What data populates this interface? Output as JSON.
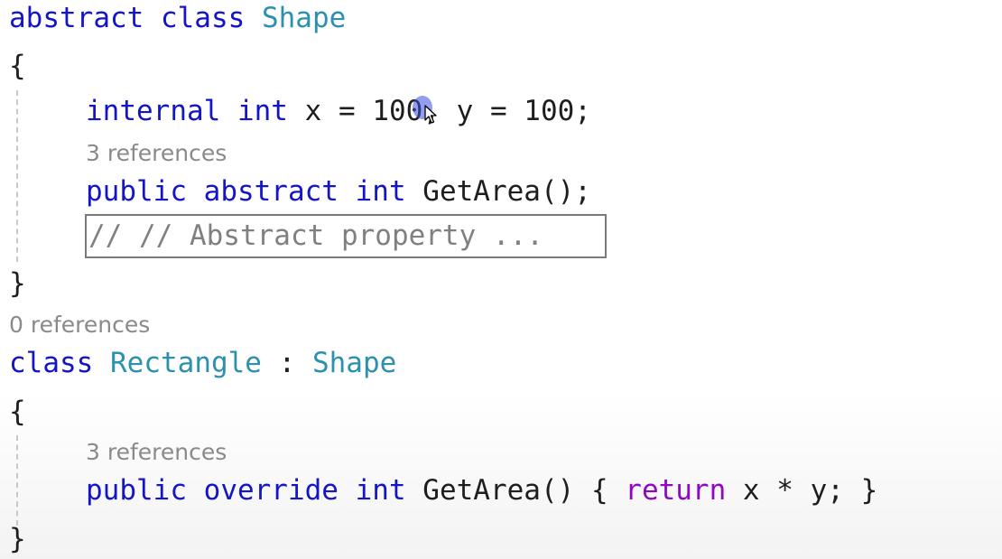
{
  "code": {
    "l1": {
      "abstract": "abstract",
      "class": "class",
      "name": "Shape"
    },
    "l2": {
      "brace": "{"
    },
    "l3": {
      "internal": "internal",
      "int": "int",
      "rest_a": " x = ",
      "num_a": "100",
      "rest_b": ", y = 100;"
    },
    "lens1": "3 references",
    "l4": {
      "public": "public",
      "abstract": "abstract",
      "int": "int",
      "rest": " GetArea();"
    },
    "collapsed_block": "// // Abstract property ...",
    "l5": {
      "brace": "}"
    },
    "lens2": "0 references",
    "l6": {
      "class": "class",
      "name": "Rectangle",
      "colon": " : ",
      "base": "Shape"
    },
    "l7": {
      "brace": "{"
    },
    "lens3": "3 references",
    "l8": {
      "public": "public",
      "override": "override",
      "int": "int",
      "mid": " GetArea() { ",
      "return": "return",
      "end": " x * y; }"
    },
    "l9": {
      "brace": "}"
    }
  },
  "icons": {
    "mouse_pointer": "arrow-pointer-icon"
  },
  "colors": {
    "keyword": "#0000ff",
    "type_name": "#2b91af",
    "control_keyword": "#8f08c4",
    "code_lens": "#8a8a8a",
    "collapsed_text": "#808080"
  }
}
